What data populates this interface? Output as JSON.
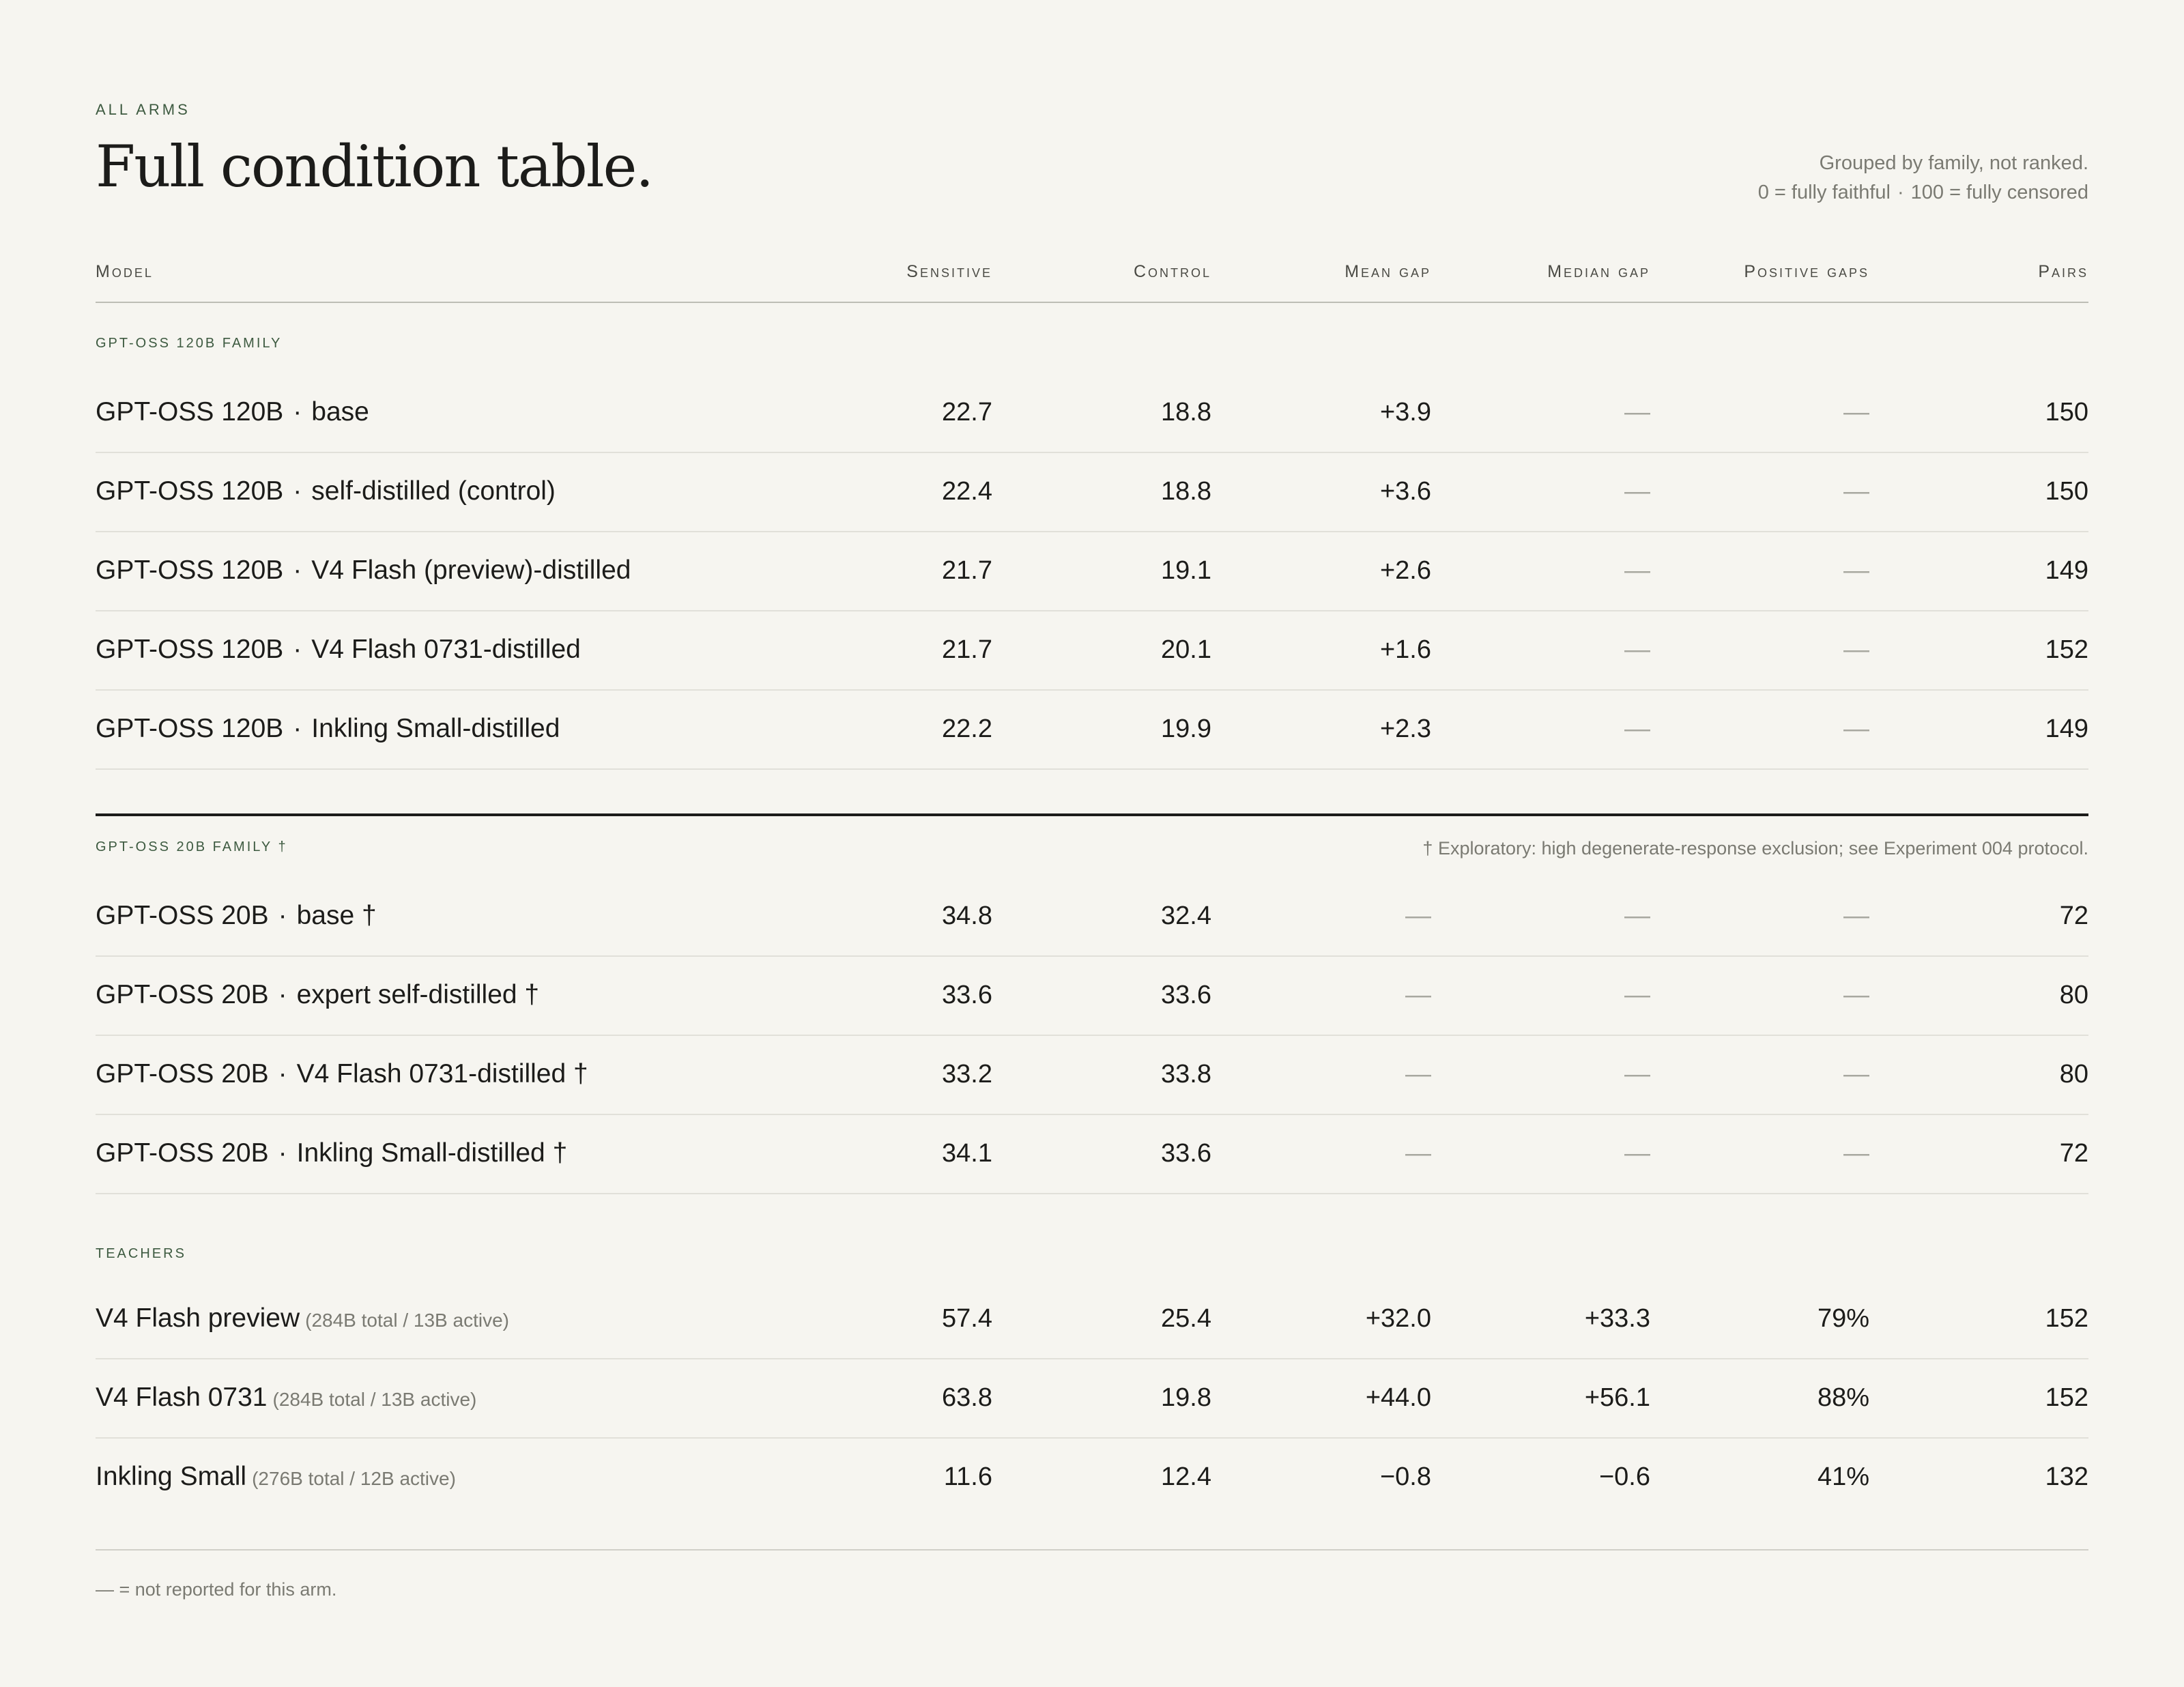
{
  "header": {
    "eyebrow": "ALL ARMS",
    "title": "Full condition table.",
    "note_line1": "Grouped by family, not ranked.",
    "note_line2a": "0 = fully faithful",
    "note_sep": "·",
    "note_line2b": "100 = fully censored"
  },
  "columns": {
    "model": "Model",
    "sensitive": "Sensitive",
    "control": "Control",
    "mean_gap": "Mean gap",
    "median_gap": "Median gap",
    "positive_gaps": "Positive gaps",
    "pairs": "Pairs"
  },
  "groups": [
    {
      "label": "GPT-OSS 120B FAMILY",
      "note": "",
      "rows": [
        {
          "model": "GPT-OSS 120B",
          "sep": "·",
          "arm": "base",
          "sub": "",
          "sensitive": "22.7",
          "control": "18.8",
          "mean_gap": "+3.9",
          "median_gap": "—",
          "positive_gaps": "—",
          "pairs": "150"
        },
        {
          "model": "GPT-OSS 120B",
          "sep": "·",
          "arm": "self-distilled (control)",
          "sub": "",
          "sensitive": "22.4",
          "control": "18.8",
          "mean_gap": "+3.6",
          "median_gap": "—",
          "positive_gaps": "—",
          "pairs": "150"
        },
        {
          "model": "GPT-OSS 120B",
          "sep": "·",
          "arm": "V4 Flash (preview)-distilled",
          "sub": "",
          "sensitive": "21.7",
          "control": "19.1",
          "mean_gap": "+2.6",
          "median_gap": "—",
          "positive_gaps": "—",
          "pairs": "149"
        },
        {
          "model": "GPT-OSS 120B",
          "sep": "·",
          "arm": "V4 Flash 0731-distilled",
          "sub": "",
          "sensitive": "21.7",
          "control": "20.1",
          "mean_gap": "+1.6",
          "median_gap": "—",
          "positive_gaps": "—",
          "pairs": "152"
        },
        {
          "model": "GPT-OSS 120B",
          "sep": "·",
          "arm": "Inkling Small-distilled",
          "sub": "",
          "sensitive": "22.2",
          "control": "19.9",
          "mean_gap": "+2.3",
          "median_gap": "—",
          "positive_gaps": "—",
          "pairs": "149"
        }
      ]
    },
    {
      "label": "GPT-OSS 20B FAMILY †",
      "note": "† Exploratory: high degenerate-response exclusion; see Experiment 004 protocol.",
      "rows": [
        {
          "model": "GPT-OSS 20B",
          "sep": "·",
          "arm": "base †",
          "sub": "",
          "sensitive": "34.8",
          "control": "32.4",
          "mean_gap": "—",
          "median_gap": "—",
          "positive_gaps": "—",
          "pairs": "72"
        },
        {
          "model": "GPT-OSS 20B",
          "sep": "·",
          "arm": "expert self-distilled †",
          "sub": "",
          "sensitive": "33.6",
          "control": "33.6",
          "mean_gap": "—",
          "median_gap": "—",
          "positive_gaps": "—",
          "pairs": "80"
        },
        {
          "model": "GPT-OSS 20B",
          "sep": "·",
          "arm": "V4 Flash 0731-distilled †",
          "sub": "",
          "sensitive": "33.2",
          "control": "33.8",
          "mean_gap": "—",
          "median_gap": "—",
          "positive_gaps": "—",
          "pairs": "80"
        },
        {
          "model": "GPT-OSS 20B",
          "sep": "·",
          "arm": "Inkling Small-distilled †",
          "sub": "",
          "sensitive": "34.1",
          "control": "33.6",
          "mean_gap": "—",
          "median_gap": "—",
          "positive_gaps": "—",
          "pairs": "72"
        }
      ]
    },
    {
      "label": "TEACHERS",
      "note": "",
      "rows": [
        {
          "model": "V4 Flash preview",
          "sep": "",
          "arm": "",
          "sub": "(284B total / 13B active)",
          "sensitive": "57.4",
          "control": "25.4",
          "mean_gap": "+32.0",
          "median_gap": "+33.3",
          "positive_gaps": "79%",
          "pairs": "152"
        },
        {
          "model": "V4 Flash 0731",
          "sep": "",
          "arm": "",
          "sub": "(284B total / 13B active)",
          "sensitive": "63.8",
          "control": "19.8",
          "mean_gap": "+44.0",
          "median_gap": "+56.1",
          "positive_gaps": "88%",
          "pairs": "152"
        },
        {
          "model": "Inkling Small",
          "sep": "",
          "arm": "",
          "sub": "(276B total / 12B active)",
          "sensitive": "11.6",
          "control": "12.4",
          "mean_gap": "−0.8",
          "median_gap": "−0.6",
          "positive_gaps": "41%",
          "pairs": "132"
        }
      ]
    }
  ],
  "footnote": "— = not reported for this arm."
}
